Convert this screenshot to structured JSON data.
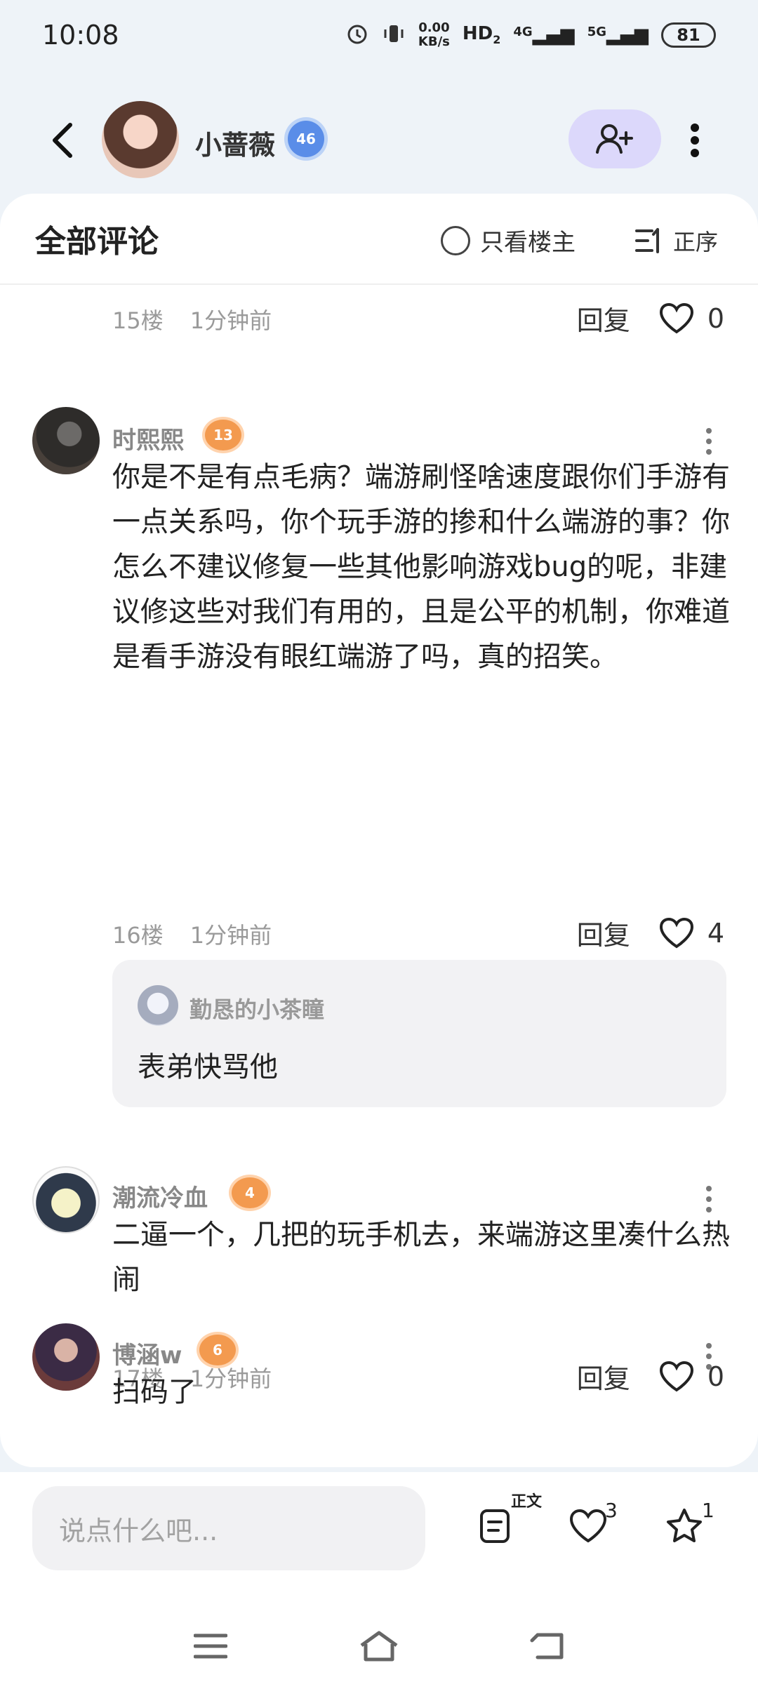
{
  "status_bar": {
    "time": "10:08",
    "net_speed_value": "0.00",
    "net_speed_unit": "KB/s",
    "hd_label": "HD",
    "hd_sub": "2",
    "signal_4g": "4G",
    "signal_5g": "5G",
    "battery": "81"
  },
  "header": {
    "author_name": "小蔷薇",
    "author_level": "46"
  },
  "comments_panel": {
    "title": "全部评论",
    "only_op_label": "只看楼主",
    "sort_label": "正序"
  },
  "partial_comment": {
    "floor": "15楼",
    "time": "1分钟前",
    "reply_label": "回复",
    "likes": "0"
  },
  "comments": [
    {
      "name": "时熙熙",
      "level": "13",
      "text": "你是不是有点毛病？端游刷怪啥速度跟你们手游有一点关系吗，你个玩手游的掺和什么端游的事？你怎么不建议修复一些其他影响游戏bug的呢，非建议修这些对我们有用的，且是公平的机制，你难道是看手游没有眼红端游了吗，真的招笑。",
      "floor": "16楼",
      "time": "1分钟前",
      "reply_label": "回复",
      "likes": "4",
      "sub_reply": {
        "name": "勤恳的小茶瞳",
        "text": "表弟快骂他"
      }
    },
    {
      "name": "潮流冷血",
      "level": "4",
      "text": "二逼一个，几把的玩手机去，来端游这里凑什么热闹",
      "floor": "17楼",
      "time": "1分钟前",
      "reply_label": "回复",
      "likes": "0"
    },
    {
      "name": "博涵w",
      "level": "6",
      "text": "扫码了"
    }
  ],
  "bottom_bar": {
    "input_placeholder": "说点什么吧...",
    "post_label": "正文",
    "like_count": "3",
    "favorite_count": "1"
  }
}
